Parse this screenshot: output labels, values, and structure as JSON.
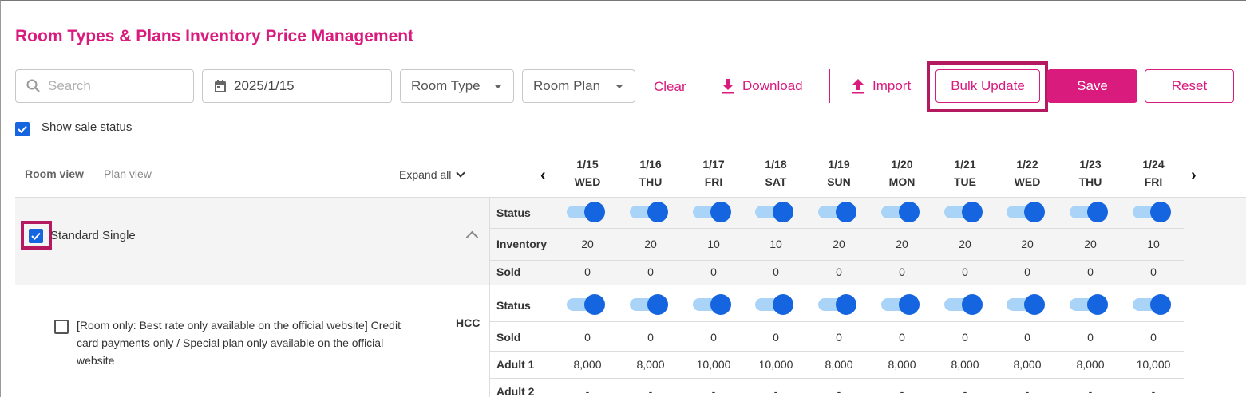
{
  "title": "Room Types & Plans Inventory Price Management",
  "toolbar": {
    "search_placeholder": "Search",
    "date": "2025/1/15",
    "room_type": "Room Type",
    "room_plan": "Room Plan",
    "clear": "Clear",
    "download": "Download",
    "import": "Import",
    "bulk_update": "Bulk Update",
    "save": "Save",
    "reset": "Reset"
  },
  "show_sale_status": {
    "label": "Show sale status",
    "checked": true
  },
  "views": {
    "room": "Room view",
    "plan": "Plan view",
    "expand_all": "Expand all"
  },
  "nav": {
    "prev": "‹",
    "next": "›"
  },
  "dates": [
    {
      "date": "1/15",
      "day": "WED"
    },
    {
      "date": "1/16",
      "day": "THU"
    },
    {
      "date": "1/17",
      "day": "FRI"
    },
    {
      "date": "1/18",
      "day": "SAT"
    },
    {
      "date": "1/19",
      "day": "SUN"
    },
    {
      "date": "1/20",
      "day": "MON"
    },
    {
      "date": "1/21",
      "day": "TUE"
    },
    {
      "date": "1/22",
      "day": "WED"
    },
    {
      "date": "1/23",
      "day": "THU"
    },
    {
      "date": "1/24",
      "day": "FRI"
    }
  ],
  "room": {
    "name": "Standard Single",
    "checked": true,
    "labels": {
      "status": "Status",
      "inventory": "Inventory",
      "sold": "Sold"
    },
    "status": [
      true,
      true,
      true,
      true,
      true,
      true,
      true,
      true,
      true,
      true
    ],
    "inventory": [
      "20",
      "20",
      "10",
      "10",
      "20",
      "20",
      "20",
      "20",
      "20",
      "10"
    ],
    "sold": [
      "0",
      "0",
      "0",
      "0",
      "0",
      "0",
      "0",
      "0",
      "0",
      "0"
    ]
  },
  "plan": {
    "name": "[Room only: Best rate only available on the official website] Credit card payments only / Special plan only available on the official website",
    "code": "HCC",
    "checked": false,
    "labels": {
      "status": "Status",
      "sold": "Sold",
      "adult1": "Adult 1",
      "adult2": "Adult 2"
    },
    "status": [
      true,
      true,
      true,
      true,
      true,
      true,
      true,
      true,
      true,
      true
    ],
    "sold": [
      "0",
      "0",
      "0",
      "0",
      "0",
      "0",
      "0",
      "0",
      "0",
      "0"
    ],
    "adult1": [
      "8,000",
      "8,000",
      "10,000",
      "10,000",
      "8,000",
      "8,000",
      "8,000",
      "8,000",
      "8,000",
      "10,000"
    ],
    "adult2": [
      "-",
      "-",
      "-",
      "-",
      "-",
      "-",
      "-",
      "-",
      "-",
      "-"
    ]
  },
  "colors": {
    "accent": "#d81b7d",
    "toggle_on": "#1565e0",
    "toggle_track": "#a9d3f7",
    "highlight": "#b5195f"
  }
}
